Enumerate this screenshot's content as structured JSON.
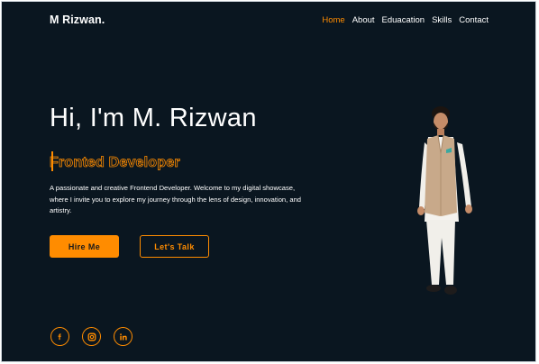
{
  "brand": "M Rizwan.",
  "nav": {
    "items": [
      "Home",
      "About",
      "Eduacation",
      "Skills",
      "Contact"
    ],
    "active_index": 0
  },
  "hero": {
    "headline": "Hi, I'm M. Rizwan",
    "role": "Fronted Developer",
    "intro": "A passionate and creative Frontend Developer. Welcome to my digital showcase, where I invite you to explore my journey through the lens of design, innovation, and artistry."
  },
  "buttons": {
    "hire": "Hire Me",
    "talk": "Let's Talk"
  },
  "social": [
    {
      "icon": "facebook-icon"
    },
    {
      "icon": "instagram-icon"
    },
    {
      "icon": "linkedin-icon"
    }
  ],
  "colors": {
    "background": "#0a1620",
    "accent": "#ff8c00",
    "text": "#ffffff"
  }
}
